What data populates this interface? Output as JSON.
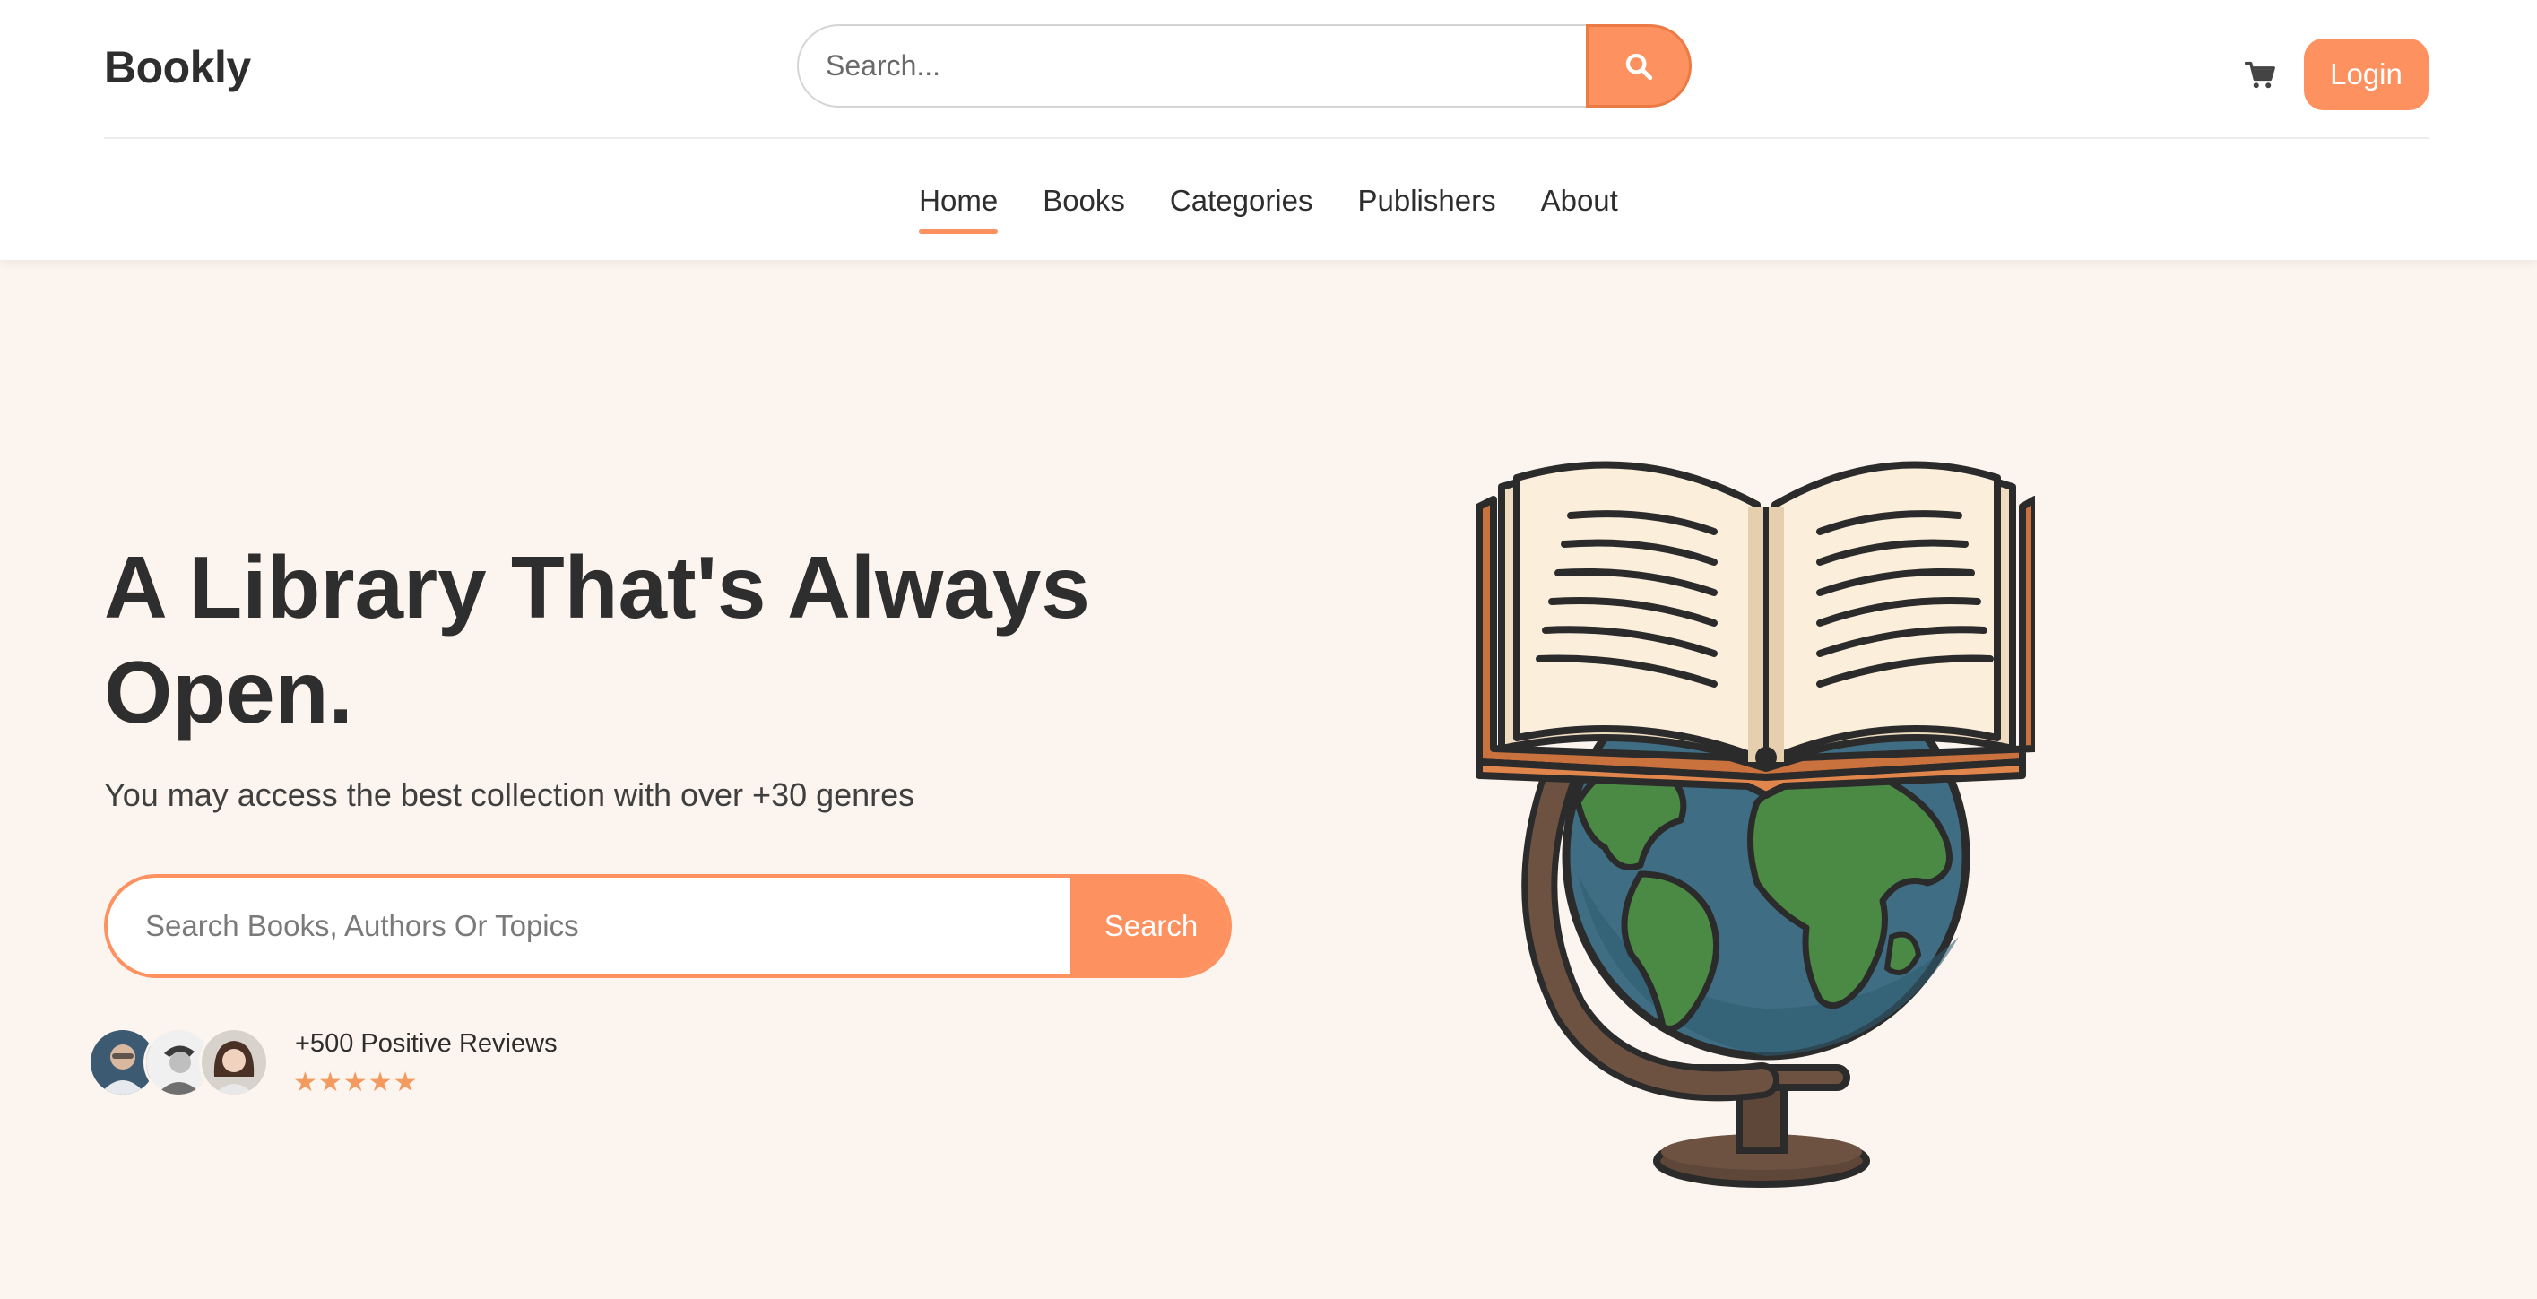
{
  "header": {
    "logo": "Bookly",
    "search_placeholder": "Search...",
    "login_label": "Login"
  },
  "nav": {
    "items": [
      {
        "label": "Home",
        "active": true
      },
      {
        "label": "Books"
      },
      {
        "label": "Categories"
      },
      {
        "label": "Publishers"
      },
      {
        "label": "About"
      }
    ]
  },
  "hero": {
    "title": "A Library That's Always Open.",
    "subtitle": "You may access the best collection with over +30 genres",
    "search_placeholder": "Search Books, Authors Or Topics",
    "search_button": "Search",
    "reviews_text": "+500 Positive Reviews",
    "stars": "★★★★★",
    "rating": 5
  },
  "icons": {
    "search": "search-icon",
    "cart": "cart-icon"
  },
  "colors": {
    "accent": "#fd915f",
    "background": "#fcf4ee",
    "text": "#2e2e2e"
  }
}
